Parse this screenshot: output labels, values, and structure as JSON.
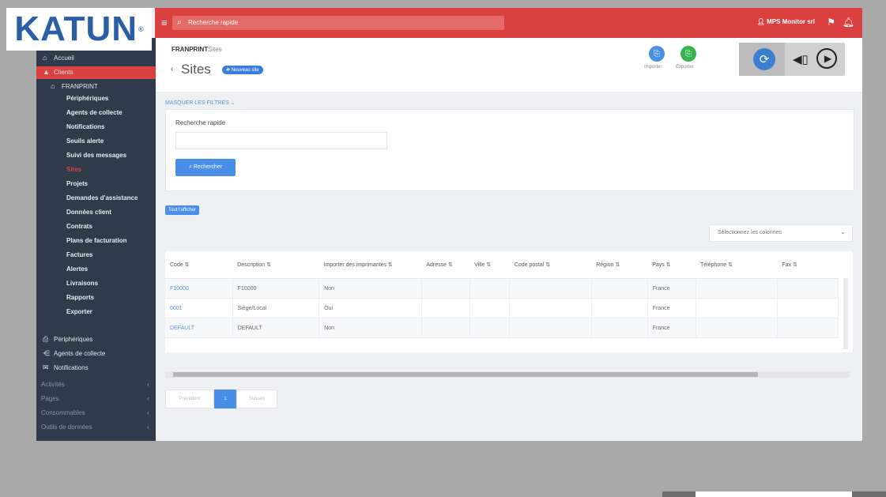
{
  "logo": {
    "text": "KATUN",
    "mark": "®"
  },
  "topbar": {
    "menu_icon": "≡",
    "search_icon": "⌕",
    "search_text": "Recherche rapide",
    "user_text": "MPS Monitor srl",
    "flag_icon": "⚑",
    "bell_icon": "🔔︎",
    "user_icon": "👤︎"
  },
  "sidebar": {
    "accueil": "Accueil",
    "clients": "Clients",
    "company": "FRANPRINT",
    "sub_items": [
      "Périphériques",
      "Agents de collecte",
      "Notifications",
      "Seuils alerte",
      "Suivi des messages",
      "Sites",
      "Projets",
      "Demandes d'assistance",
      "Données client",
      "Contrats",
      "Plans de facturation",
      "Factures",
      "Alertes",
      "Livraisons",
      "Rapports",
      "Exporter"
    ],
    "bottom_items": [
      "Périphériques",
      "Agents de collecte",
      "Notifications"
    ],
    "muted_items": [
      "Activités",
      "Pages",
      "Consommables",
      "Outils de données"
    ],
    "chevron": "‹"
  },
  "header": {
    "crumb1": "FRANPRINT",
    "crumb_sep": "/",
    "crumb2": "Sites",
    "back": "‹",
    "title": "Sites",
    "new_badge": "✚ Nouveau site",
    "import_label": "Importer",
    "export_label": "Exporter",
    "import_icon": "⎘",
    "export_icon": "⎘"
  },
  "media": {
    "rotate": "⟳",
    "volume": "◀︎▯",
    "play": "▶"
  },
  "filter": {
    "toggle": "MASQUER LES FILTRES ⌄",
    "label": "Recherche rapide",
    "input_value": "",
    "button": "⌕ Rechercher"
  },
  "toggle_all": "Tout l'afficher",
  "column_select": {
    "text": "Sélectionnez les colonnes",
    "chev": "⌄"
  },
  "table": {
    "headers": [
      "Code ⇅",
      "Description ⇅",
      "Importer des imprimantes ⇅",
      "Adresse ⇅",
      "Ville ⇅",
      "Code postal ⇅",
      "Région ⇅",
      "Pays ⇅",
      "Téléphone ⇅",
      "Fax ⇅"
    ],
    "rows": [
      [
        "F10000",
        "F10000",
        "Non",
        "",
        "",
        "",
        "",
        "France",
        "",
        ""
      ],
      [
        "0001",
        "Siège/Local",
        "Oui",
        "",
        "",
        "",
        "",
        "France",
        "",
        ""
      ],
      [
        "DEFAULT",
        "DEFAULT",
        "Non",
        "",
        "",
        "",
        "",
        "France",
        "",
        ""
      ]
    ]
  },
  "pager": {
    "prev": "Précédent",
    "current": "1",
    "next": "Suivant"
  }
}
